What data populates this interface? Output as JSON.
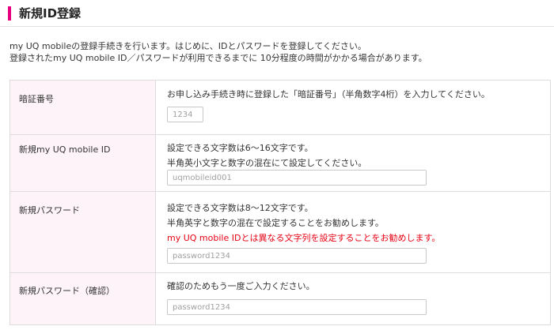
{
  "page": {
    "title": "新規ID登録",
    "intro_lines": [
      "my UQ mobileの登録手続きを行います。はじめに、IDとパスワードを登録してください。",
      "登録されたmy UQ mobile ID／パスワードが利用できるまでに 10分程度の時間がかかる場合があります。"
    ]
  },
  "form": {
    "pin": {
      "label": "暗証番号",
      "desc": [
        "お申し込み手続き時に登録した「暗証番号」（半角数字4桁）を入力してください。"
      ],
      "placeholder": "1234"
    },
    "new_id": {
      "label": "新規my UQ mobile ID",
      "desc": [
        "設定できる文字数は6～16文字です。",
        "半角英小文字と数字の混在にて設定してください。"
      ],
      "placeholder": "uqmobileid001"
    },
    "new_password": {
      "label": "新規パスワード",
      "desc": [
        "設定できる文字数は8～12文字です。",
        "半角英字と数字の混在で設定することをお勧めします。"
      ],
      "warning": "my UQ mobile IDとは異なる文字列を設定することをお勧めします。",
      "placeholder": "password1234"
    },
    "confirm_password": {
      "label": "新規パスワード（確認）",
      "desc": [
        "確認のためもう一度ご入力ください。"
      ],
      "placeholder": "password1234"
    }
  },
  "colors": {
    "accent": "#e6007e",
    "label_bg": "#fdf3f8",
    "warning": "#e60012"
  }
}
